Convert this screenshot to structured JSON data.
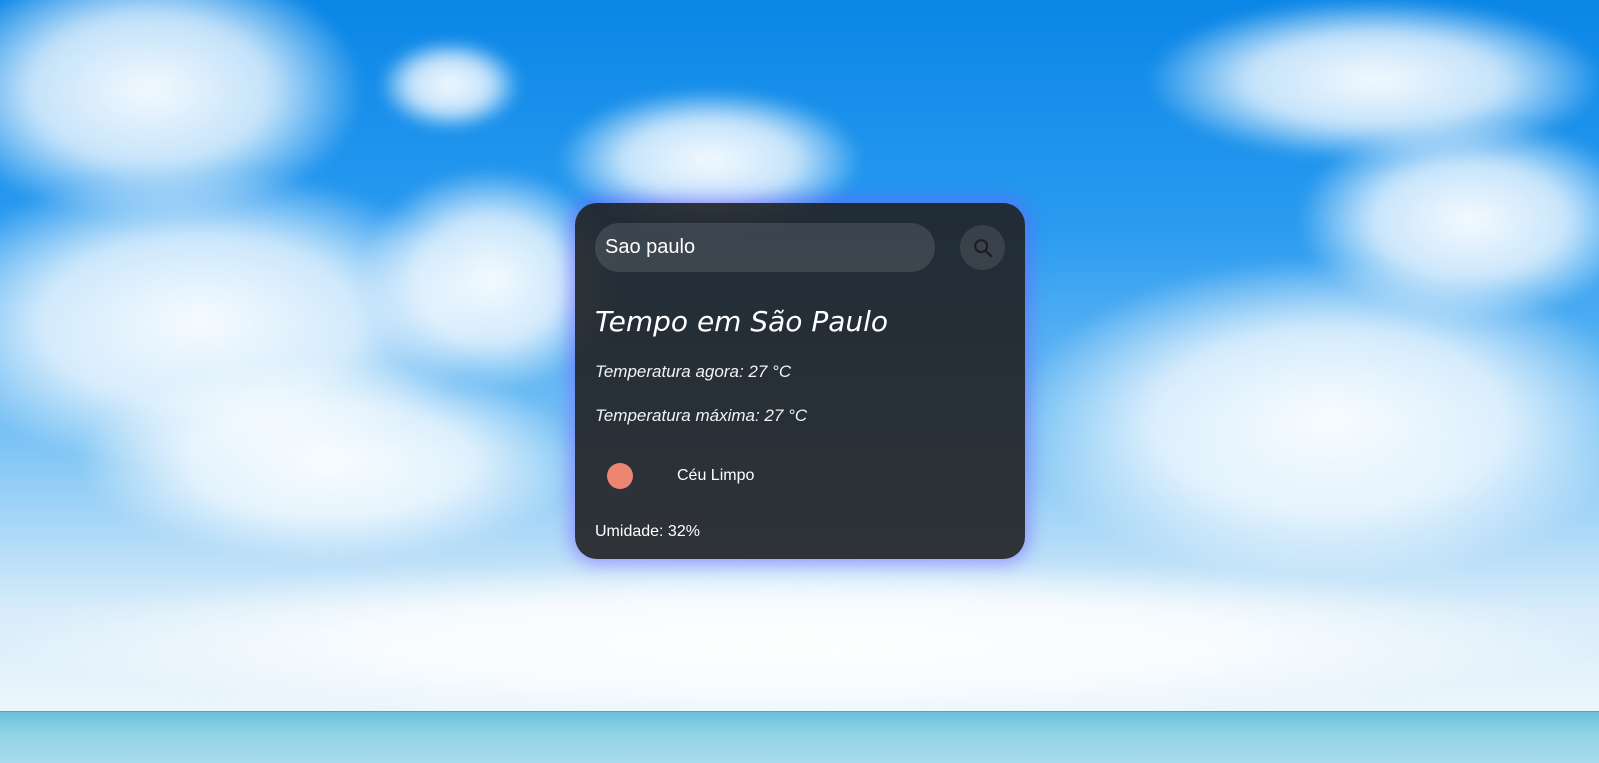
{
  "search": {
    "value": "Sao paulo",
    "button_icon": "search-icon"
  },
  "weather": {
    "title": "Tempo em São Paulo",
    "temperature_now": "Temperatura agora: 27 °C",
    "temperature_max": "Temperatura máxima: 27 °C",
    "condition_icon": "weather-icon",
    "condition": "Céu Limpo",
    "humidity": "Umidade: 32%"
  },
  "colors": {
    "card_background": "#202022",
    "card_glow": "#785aff",
    "condition_icon": "#ec8572",
    "sky": "#0a86e6"
  }
}
